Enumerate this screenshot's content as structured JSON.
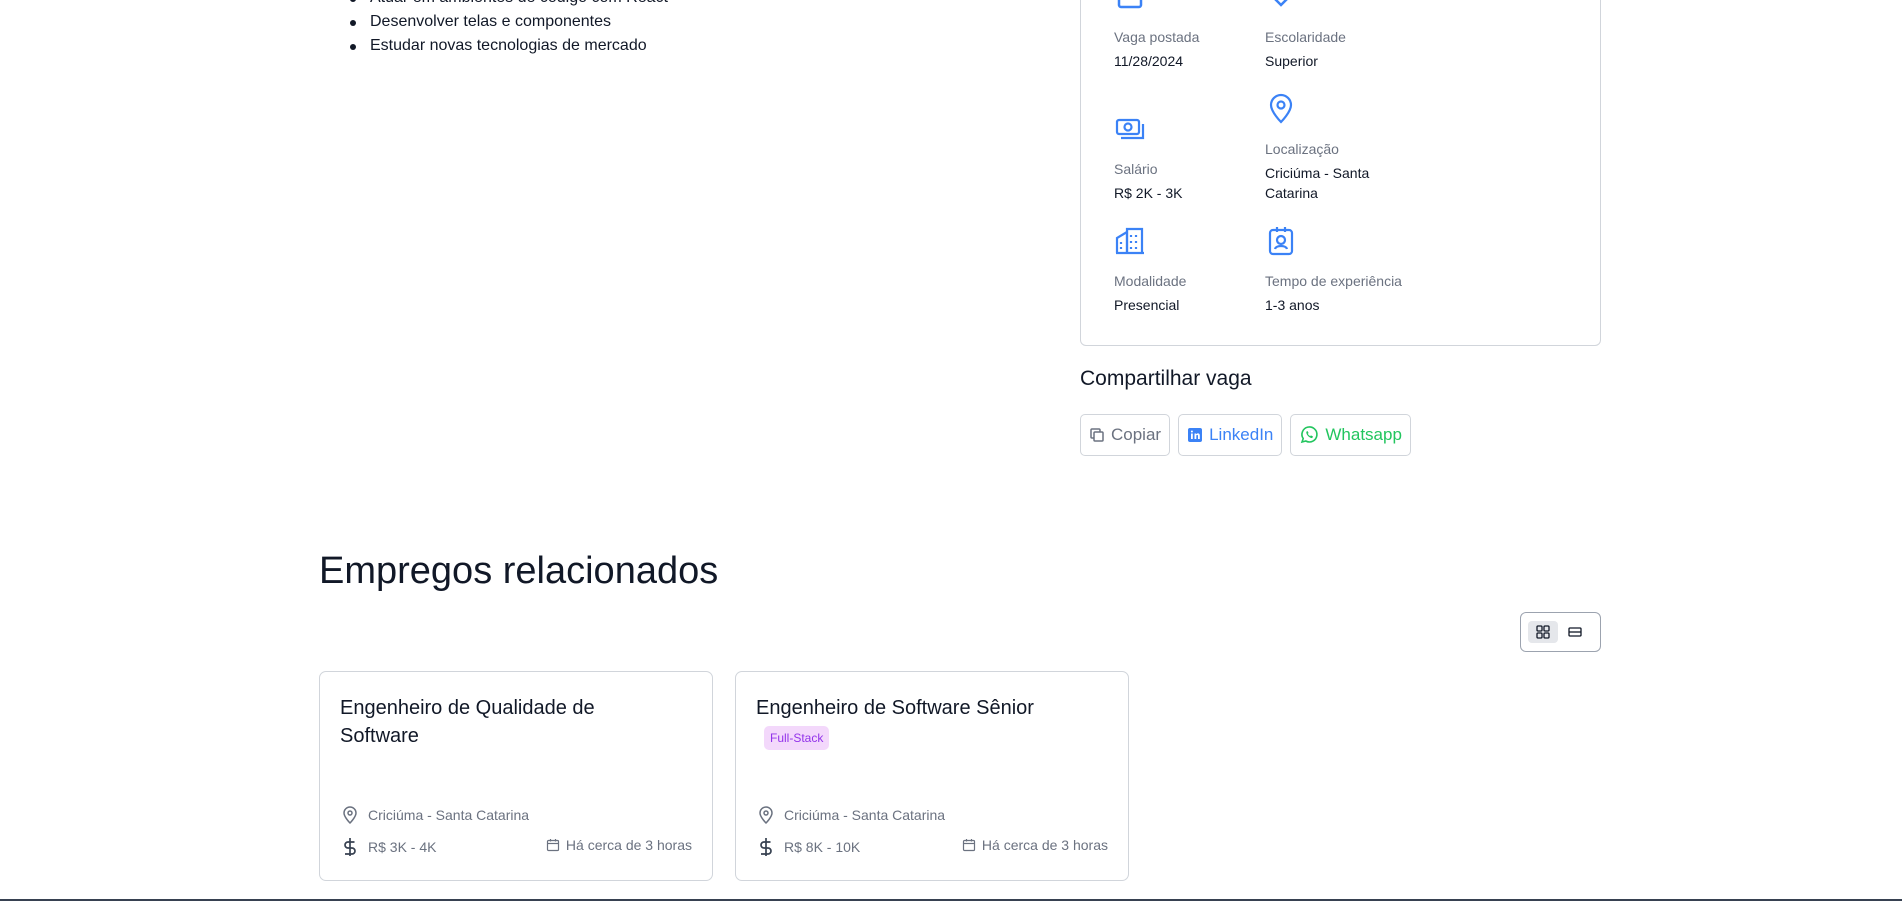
{
  "responsibilities": [
    "Atuar em ambientes de código com React",
    "Desenvolver telas e componentes",
    "Estudar novas tecnologias de mercado"
  ],
  "job_info": {
    "posted": {
      "label": "Vaga postada",
      "value": "11/28/2024",
      "icon": "calendar-icon"
    },
    "education": {
      "label": "Escolaridade",
      "value": "Superior",
      "icon": "graduation-cap-icon"
    },
    "salary": {
      "label": "Salário",
      "value": "R$ 2K - 3K",
      "icon": "money-icon"
    },
    "location": {
      "label": "Localização",
      "value": "Criciúma - Santa Catarina",
      "icon": "map-pin-icon"
    },
    "modality": {
      "label": "Modalidade",
      "value": "Presencial",
      "icon": "building-icon"
    },
    "experience": {
      "label": "Tempo de experiência",
      "value": "1-3 anos",
      "icon": "badge-icon"
    }
  },
  "share": {
    "title": "Compartilhar vaga",
    "copy_label": "Copiar",
    "linkedin_label": "LinkedIn",
    "whatsapp_label": "Whatsapp"
  },
  "related": {
    "title": "Empregos relacionados",
    "view_toggle": {
      "grid_icon": "grid-icon",
      "list_icon": "list-icon",
      "active": "grid"
    },
    "jobs": [
      {
        "title": "Engenheiro de Qualidade de Software",
        "tag": "",
        "location": "Criciúma - Santa Catarina",
        "salary": "R$ 3K - 4K",
        "posted": "Há cerca de 3 horas"
      },
      {
        "title": "Engenheiro de Software Sênior",
        "tag": "Full-Stack",
        "location": "Criciúma - Santa Catarina",
        "salary": "R$ 8K - 10K",
        "posted": "Há cerca de 3 horas"
      }
    ]
  },
  "colors": {
    "accent": "#3b82f6",
    "whatsapp": "#22c55e",
    "tag_bg": "#f3d8fb",
    "tag_text": "#9333ea"
  }
}
